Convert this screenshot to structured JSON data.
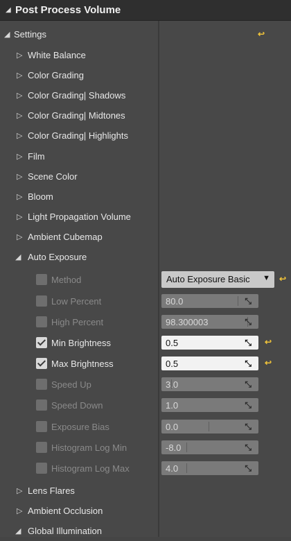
{
  "panel": {
    "title": "Post Process Volume"
  },
  "settings": {
    "label": "Settings"
  },
  "collapsed_sections": [
    "White Balance",
    "Color Grading",
    "Color Grading| Shadows",
    "Color Grading| Midtones",
    "Color Grading| Highlights",
    "Film",
    "Scene Color",
    "Bloom",
    "Light Propagation Volume",
    "Ambient Cubemap"
  ],
  "auto_exposure": {
    "label": "Auto Exposure",
    "method": {
      "label": "Method",
      "value": "Auto Exposure Basic"
    },
    "low_percent": {
      "label": "Low Percent",
      "value": "80.0"
    },
    "high_percent": {
      "label": "High Percent",
      "value": "98.300003"
    },
    "min_brightness": {
      "label": "Min Brightness",
      "value": "0.5"
    },
    "max_brightness": {
      "label": "Max Brightness",
      "value": "0.5"
    },
    "speed_up": {
      "label": "Speed Up",
      "value": "3.0"
    },
    "speed_down": {
      "label": "Speed Down",
      "value": "1.0"
    },
    "exposure_bias": {
      "label": "Exposure Bias",
      "value": "0.0"
    },
    "histogram_log_min": {
      "label": "Histogram Log Min",
      "value": "-8.0"
    },
    "histogram_log_max": {
      "label": "Histogram Log Max",
      "value": "4.0"
    }
  },
  "after_sections": [
    "Lens Flares",
    "Ambient Occlusion"
  ],
  "global_illumination": {
    "label": "Global Illumination"
  },
  "icons": {
    "expanded": "▲",
    "collapsed": "▷",
    "reset": "↩",
    "dropdown": "▼",
    "drag_handle": "⤡"
  },
  "colors": {
    "panel_bg": "#484848",
    "header_bg": "#2f2f2f",
    "reset_arrow": "#f0c33a"
  }
}
